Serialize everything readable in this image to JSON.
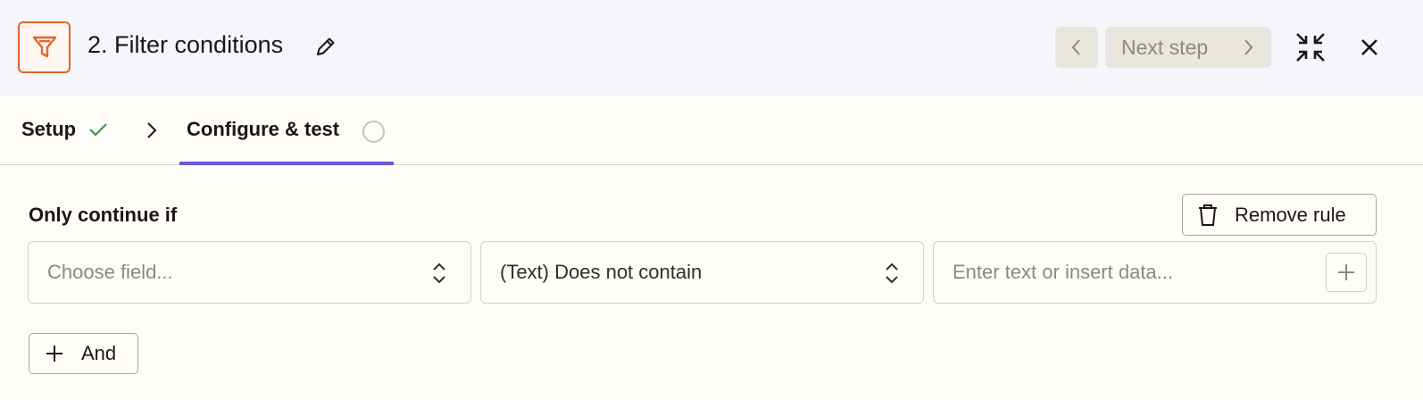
{
  "header": {
    "step_title": "2. Filter conditions",
    "app_icon": "filter-icon",
    "brand_color": "#e4642a",
    "prev_button_icon": "chevron-left-icon",
    "next_step_label": "Next step",
    "collapse_icon": "collapse-icon",
    "close_icon": "close-icon"
  },
  "tabs": {
    "setup_label": "Setup",
    "setup_status": "complete",
    "configure_label": "Configure & test",
    "configure_status": "incomplete",
    "active_tab": "Configure & test",
    "accent_color": "#6b5ad9"
  },
  "rule": {
    "label": "Only continue if",
    "remove_label": "Remove rule",
    "field_placeholder": "Choose field...",
    "operator_value": "(Text) Does not contain",
    "value_placeholder": "Enter text or insert data..."
  },
  "and_button": {
    "label": "And"
  }
}
